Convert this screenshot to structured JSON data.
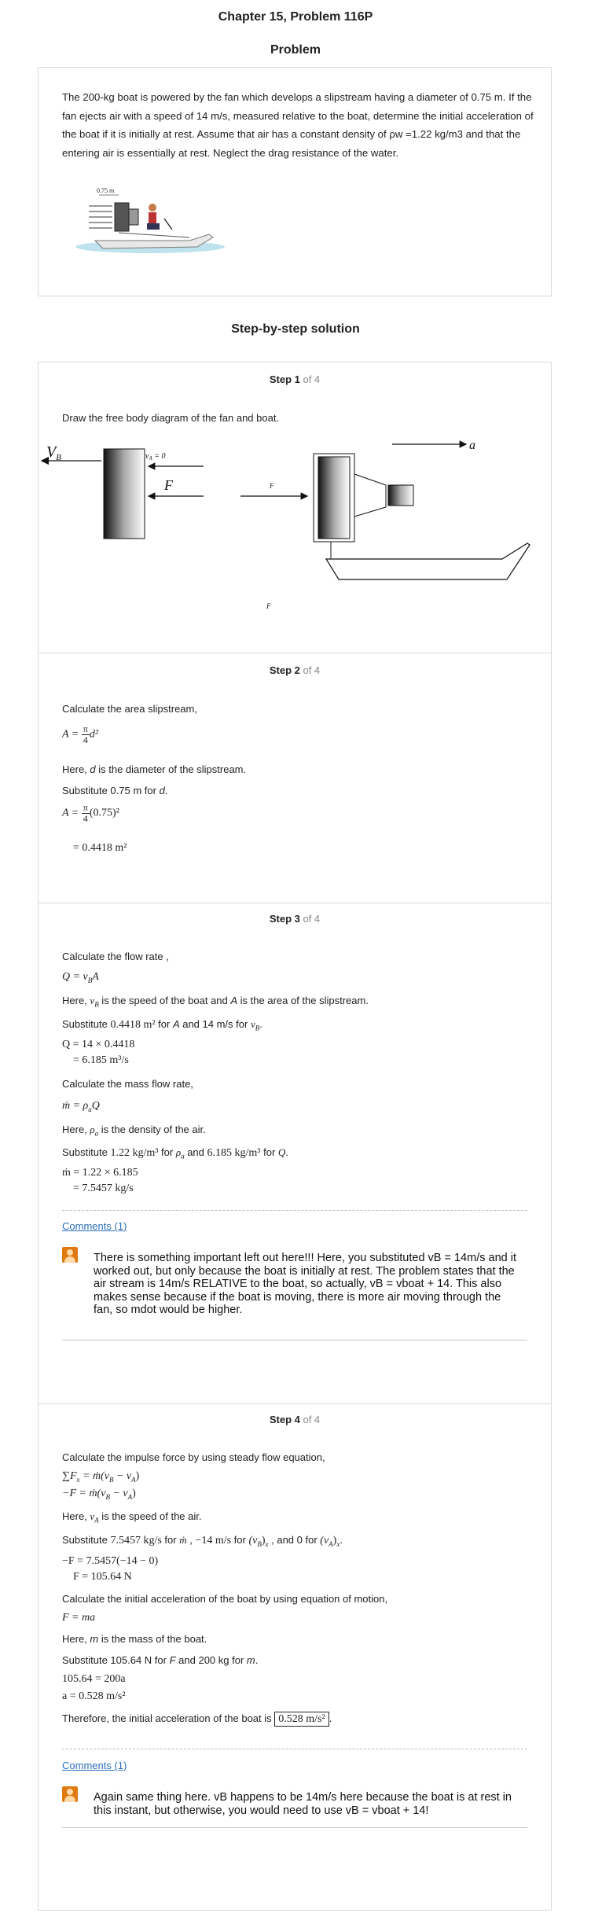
{
  "header": {
    "chapter_title": "Chapter 15, Problem 116P",
    "problem_heading": "Problem"
  },
  "problem": {
    "text": "The 200-kg boat is powered by the fan which develops a slipstream having a diameter of 0.75 m. If the fan ejects air with a speed of 14 m/s, measured relative to the boat, determine the initial acceleration of the boat if it is initially at rest. Assume that air has a constant density of ρw =1.22 kg/m3 and that the entering air is essentially at rest. Neglect the drag resistance of the water.",
    "figure_label": "0.75 m"
  },
  "solution_heading": "Step-by-step solution",
  "steps": {
    "s1": {
      "num": "Step 1",
      "of": " of 4",
      "intro": "Draw the free body diagram of the fan and boat.",
      "fig": {
        "vb": "V",
        "vb_sub": "B",
        "va": "v",
        "va_sub": "A",
        "va_eq": " = 0",
        "f": "F",
        "fmid": "F",
        "a": "a",
        "fbottom": "F"
      }
    },
    "s2": {
      "num": "Step 2",
      "of": " of 4",
      "l1": "Calculate the area slipstream,",
      "e1_lhs": "A =",
      "e1_num": "π",
      "e1_den": "4",
      "e1_rhs": "d²",
      "l2_pre": "Here, ",
      "l2_var": "d",
      "l2_post": " is the diameter of the slipstream.",
      "l3_pre": "Substitute 0.75 m for ",
      "l3_var": "d",
      "l3_post": ".",
      "e2_lhs": "A =",
      "e2_num": "π",
      "e2_den": "4",
      "e2_rhs": "(0.75)²",
      "e3": "= 0.4418 m²"
    },
    "s3": {
      "num": "Step 3",
      "of": " of 4",
      "l1": "Calculate the flow rate ,",
      "e1": "Q = v",
      "e1_sub": "B",
      "e1_post": "A",
      "l2_pre": "Here, ",
      "l2_v": "v",
      "l2_sub": "B",
      "l2_mid": " is the speed of the boat and ",
      "l2_A": "A",
      "l2_post": " is the area of the slipstream.",
      "l3_pre": "Substitute ",
      "l3_val": "0.4418 m²",
      "l3_mid": " for ",
      "l3_A": "A",
      "l3_mid2": " and 14 m/s for ",
      "l3_v": "v",
      "l3_sub": "B",
      "l3_post": ".",
      "e2": "Q = 14 × 0.4418",
      "e3": "= 6.185 m³/s",
      "l4": "Calculate the mass flow rate,",
      "e4": "ṁ = ρ",
      "e4_sub": "a",
      "e4_post": "Q",
      "l5_pre": "Here, ",
      "l5_v": "ρ",
      "l5_sub": "a",
      "l5_post": " is the density of the air.",
      "l6_pre": "Substitute ",
      "l6_val1": "1.22 kg/m³",
      "l6_for1": " for ",
      "l6_rho": "ρ",
      "l6_rsub": "a",
      "l6_and": " and ",
      "l6_val2": "6.185 kg/m³",
      "l6_for2": " for ",
      "l6_Q": "Q",
      "l6_post": ".",
      "e5": "ṁ = 1.22 × 6.185",
      "e6": "= 7.5457 kg/s",
      "comments_link": "Comments (1)",
      "comment": "There is something important left out here!!! Here, you substituted vB = 14m/s and it worked out, but only because the boat is initially at rest. The problem states that the air stream is 14m/s RELATIVE to the boat, so actually, vB = vboat + 14. This also makes sense because if the boat is moving, there is more air moving through the fan, so mdot would be higher."
    },
    "s4": {
      "num": "Step 4",
      "of": " of 4",
      "l1": "Calculate the impulse force by using steady flow equation,",
      "e1": "∑F",
      "e1_sub": "x",
      "e1_post": " = ṁ(v",
      "e1_b": "B",
      "e1_mid": " − v",
      "e1_a": "A",
      "e1_end": ")",
      "e2": "−F = ṁ(v",
      "e2_b": "B",
      "e2_mid": " − v",
      "e2_a": "A",
      "e2_end": ")",
      "l2_pre": "Here, ",
      "l2_v": "v",
      "l2_sub": "A",
      "l2_post": " is the speed of the air.",
      "l3_pre": "Substitute ",
      "l3_v1": "7.5457 kg/s",
      "l3_for1": " for ",
      "l3_m": "ṁ",
      "l3_c": " , ",
      "l3_v2": "−14 m/s",
      "l3_for2": " for ",
      "l3_vb": "(v",
      "l3_vbs": "B",
      "l3_vbx": ")",
      "l3_x1": "x",
      "l3_and": " , and 0 for ",
      "l3_va": "(v",
      "l3_vas": "A",
      "l3_vax": ")",
      "l3_x2": "x",
      "l3_post": ".",
      "e3": "−F = 7.5457(−14 − 0)",
      "e4": "F = 105.64 N",
      "l4": "Calculate the initial acceleration of the boat by using equation of motion,",
      "e5": "F = ma",
      "l5_pre": "Here, ",
      "l5_var": "m",
      "l5_post": " is the mass of the boat.",
      "l6_pre": "Substitute 105.64 N for ",
      "l6_F": "F",
      "l6_mid": " and 200 kg for ",
      "l6_m": "m",
      "l6_post": ".",
      "e6": "105.64 = 200a",
      "e7": "a = 0.528 m/s²",
      "l7_pre": "Therefore, the initial acceleration of the boat is ",
      "l7_val": "0.528 m/s²",
      "l7_post": ".",
      "comments_link": "Comments (1)",
      "comment": "Again same thing here. vB happens to be 14m/s here because the boat is at rest in this instant, but otherwise, you would need to use vB = vboat + 14!"
    }
  }
}
